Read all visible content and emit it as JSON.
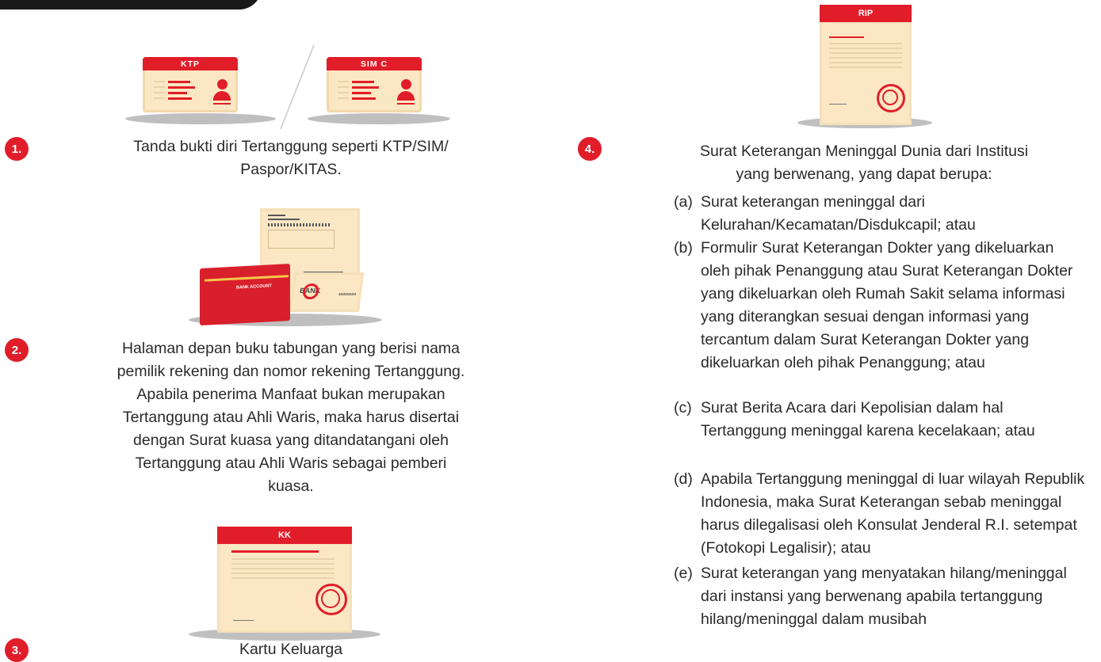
{
  "items": [
    {
      "number": "1.",
      "text_lines": [
        "Tanda bukti diri Tertanggung seperti KTP/SIM/",
        "Paspor/KITAS."
      ]
    },
    {
      "number": "2.",
      "text_lines": [
        "Halaman depan buku tabungan yang berisi nama",
        "pemilik rekening dan nomor rekening Tertanggung.",
        "Apabila penerima Manfaat bukan merupakan",
        "Tertanggung atau Ahli Waris, maka harus disertai",
        "dengan Surat kuasa yang ditandatangani oleh",
        "Tertanggung atau Ahli Waris sebagai pemberi",
        "kuasa."
      ]
    },
    {
      "number": "3.",
      "text_lines": [
        "Kartu Keluarga"
      ]
    },
    {
      "number": "4.",
      "text_lines": [
        "Surat Keterangan Meninggal Dunia dari Institusi",
        "yang berwenang, yang dapat berupa:"
      ]
    }
  ],
  "illustrations": {
    "ktp_label": "KTP",
    "sim_label": "SIM C",
    "bank_card_label": "BANK ACCOUNT",
    "bank_stamp_label": "BANK",
    "kk_label": "KK",
    "rip_label": "RIP"
  },
  "sub_items": [
    {
      "label": "(a)",
      "text": "Surat keterangan meninggal dari Kelurahan/Kecamatan/Disdukcapil; atau"
    },
    {
      "label": "(b)",
      "text": "Formulir Surat Keterangan Dokter yang dikeluarkan oleh pihak Penanggung atau Surat Keterangan Dokter yang dikeluarkan oleh Rumah Sakit selama informasi yang diterangkan sesuai dengan informasi yang tercantum dalam Surat Keterangan Dokter yang dikeluarkan oleh pihak Penanggung; atau"
    },
    {
      "label": "(c)",
      "text": "Surat Berita Acara dari Kepolisian dalam hal Tertanggung meninggal karena kecelakaan; atau"
    },
    {
      "label": "(d)",
      "text": "Apabila Tertanggung meninggal di luar wilayah Republik Indonesia, maka Surat Keterangan sebab meninggal harus dilegalisasi oleh Konsulat Jenderal R.I. setempat (Fotokopi Legalisir); atau"
    },
    {
      "label": "(e)",
      "text": "Surat keterangan yang menyatakan hilang/meninggal dari instansi yang berwenang apabila tertanggung hilang/meninggal dalam musibah"
    }
  ],
  "colors": {
    "accent": "#e11d2a",
    "card": "#fbe7c4",
    "text": "#2a2a2a"
  }
}
